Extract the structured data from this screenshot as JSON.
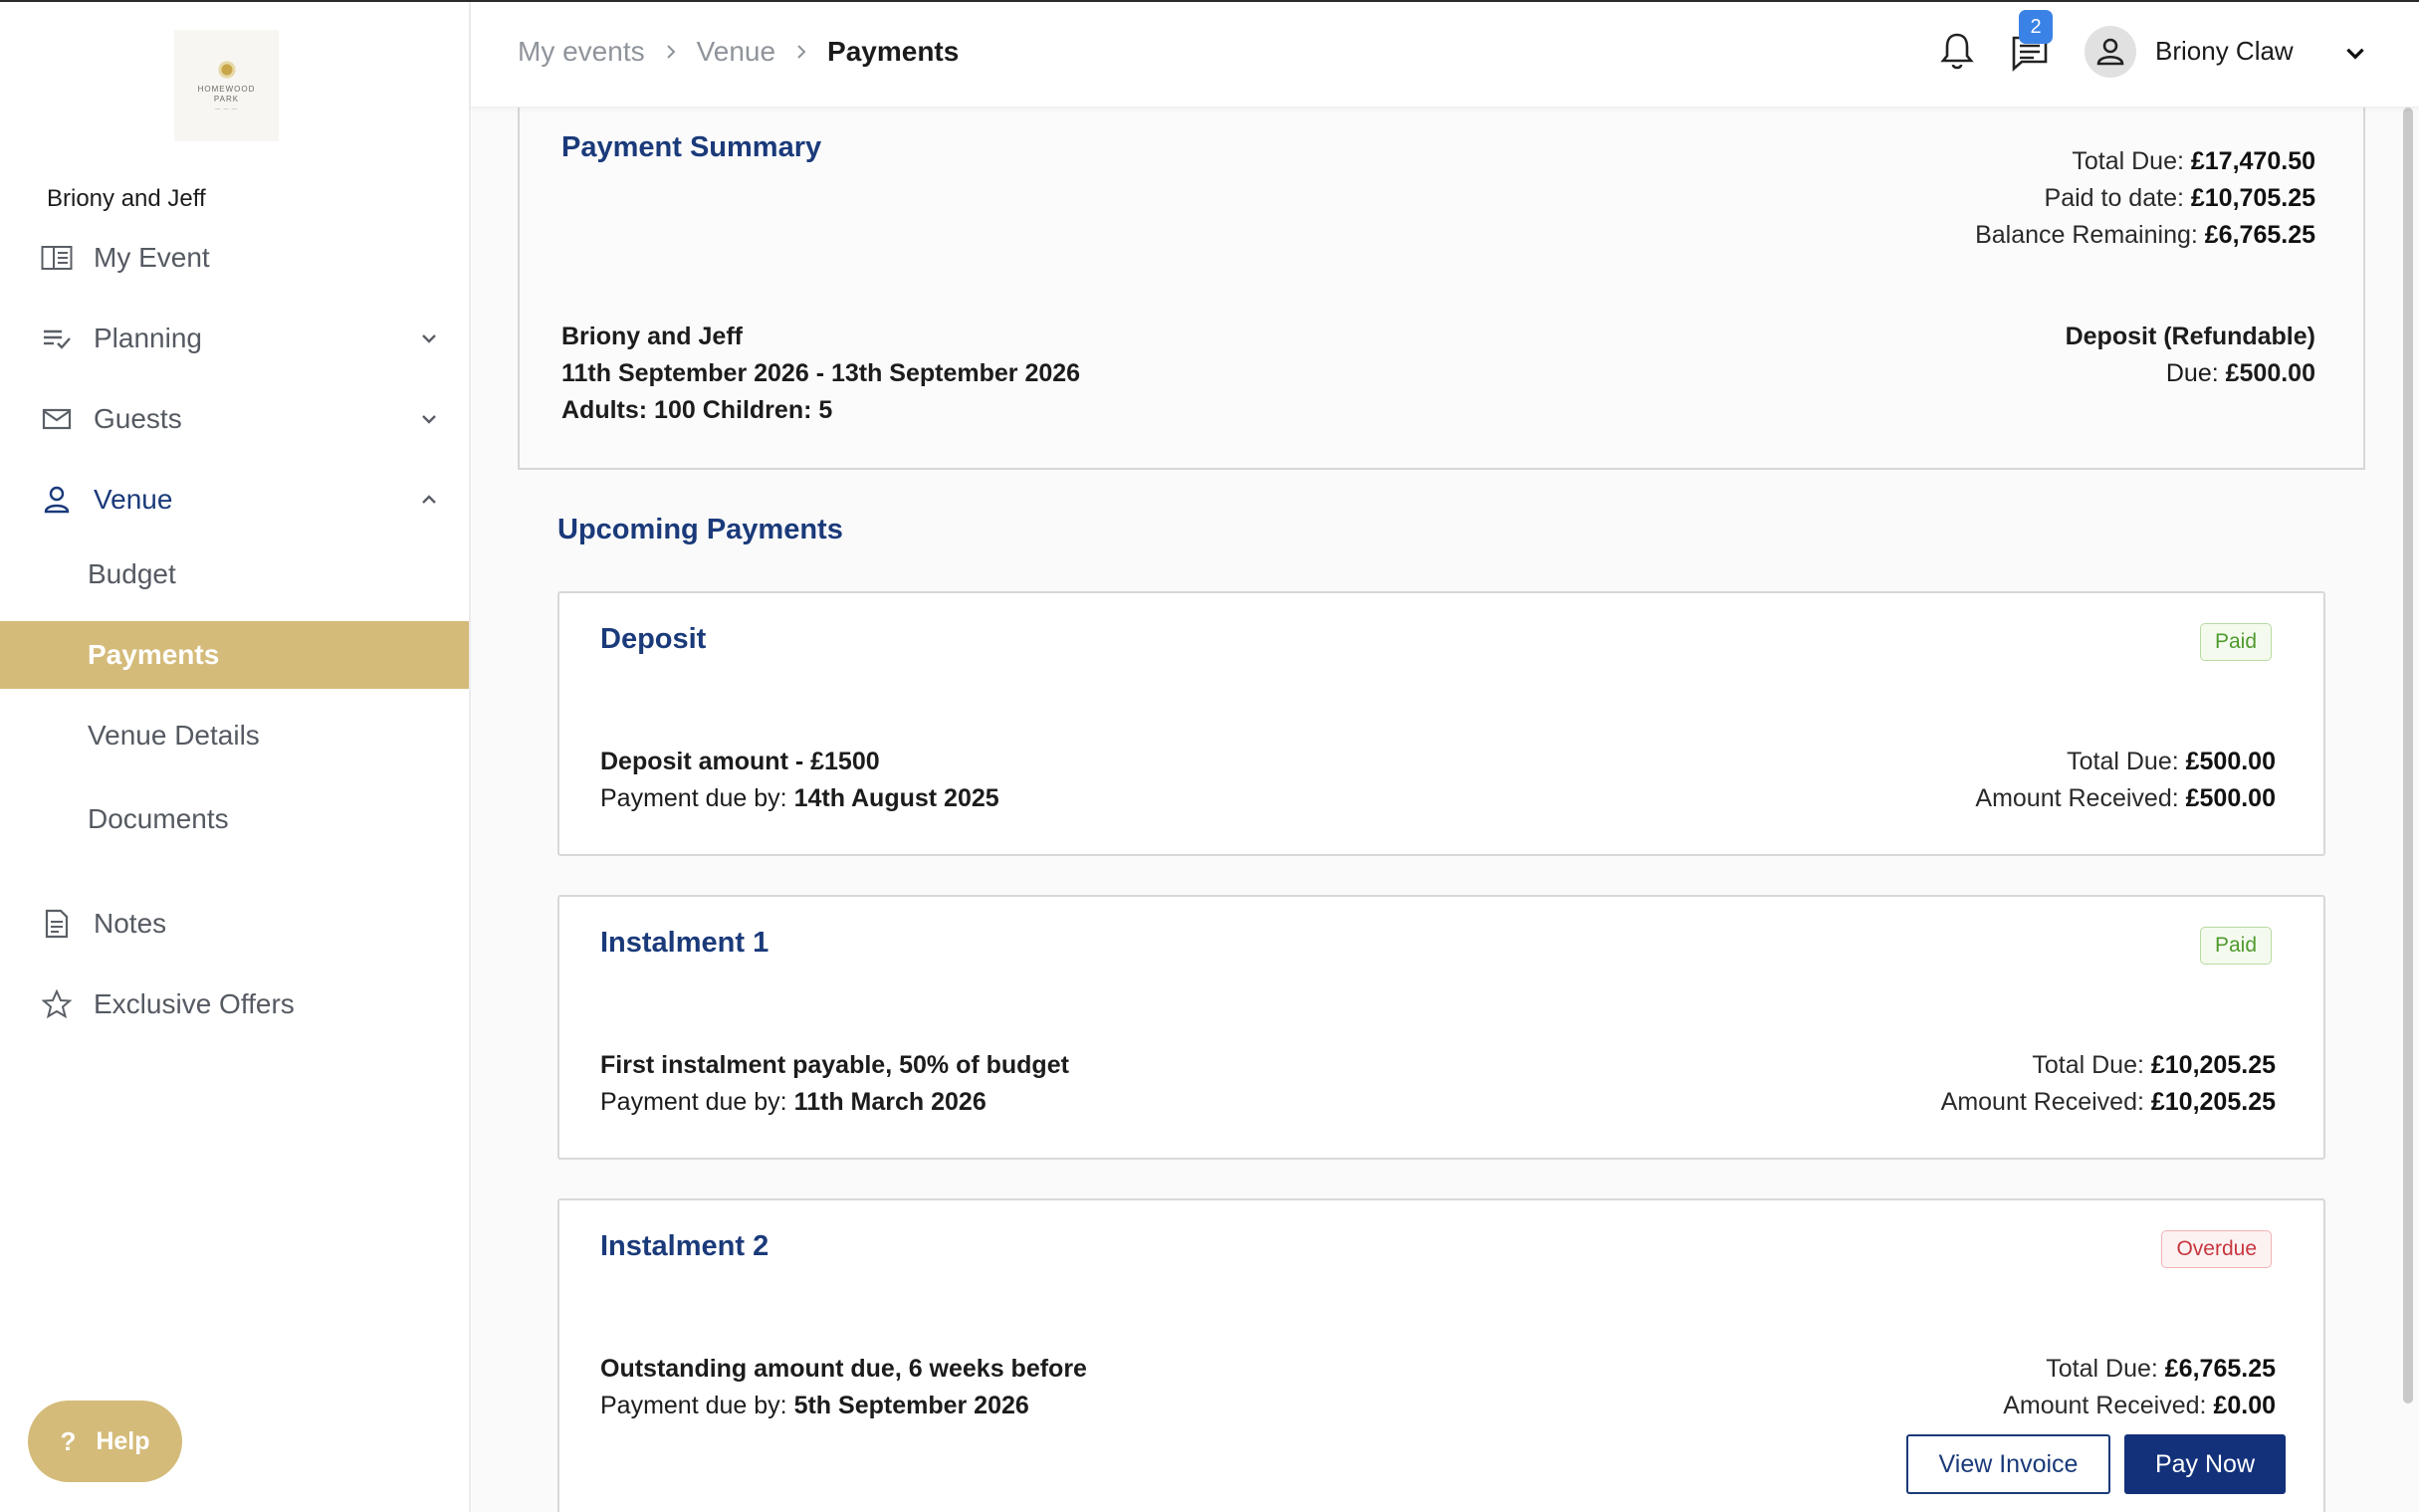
{
  "app": {
    "logo_line1": "HOMEWOOD",
    "logo_line2": "PARK",
    "event_name": "Briony and Jeff"
  },
  "colors": {
    "accent": "#d4bb7a",
    "navy": "#1a3a7a",
    "paid": "#4f9a2d",
    "overdue": "#c7373f",
    "badge_blue": "#3b82e6"
  },
  "sidebar": {
    "items": [
      {
        "label": "My Event",
        "icon": "book-icon"
      },
      {
        "label": "Planning",
        "icon": "checklist-icon"
      },
      {
        "label": "Guests",
        "icon": "mail-icon"
      },
      {
        "label": "Venue",
        "icon": "person-icon"
      }
    ],
    "venue_sub": [
      {
        "label": "Budget"
      },
      {
        "label": "Payments"
      },
      {
        "label": "Venue Details"
      },
      {
        "label": "Documents"
      }
    ],
    "notes": "Notes",
    "offers": "Exclusive Offers",
    "help": "Help"
  },
  "header": {
    "breadcrumbs": [
      "My events",
      "Venue",
      "Payments"
    ],
    "message_count": "2",
    "user_name": "Briony Claw"
  },
  "summary": {
    "title": "Payment Summary",
    "total_due_label": "Total Due:",
    "total_due": "£17,470.50",
    "paid_label": "Paid to date:",
    "paid": "£10,705.25",
    "balance_label": "Balance Remaining:",
    "balance": "£6,765.25",
    "event_name": "Briony and Jeff",
    "dates": "11th September 2026 - 13th September 2026",
    "guests": "Adults: 100 Children: 5",
    "deposit_title": "Deposit (Refundable)",
    "deposit_due_label": "Due:",
    "deposit_due": "£500.00"
  },
  "upcoming": {
    "title": "Upcoming Payments",
    "payments": [
      {
        "title": "Deposit",
        "status": "Paid",
        "description": "Deposit amount - £1500",
        "due_label": "Payment due by:",
        "due_date": "14th August 2025",
        "total_label": "Total Due:",
        "total": "£500.00",
        "received_label": "Amount Received:",
        "received": "£500.00"
      },
      {
        "title": "Instalment 1",
        "status": "Paid",
        "description": "First instalment payable, 50% of budget",
        "due_label": "Payment due by:",
        "due_date": "11th March 2026",
        "total_label": "Total Due:",
        "total": "£10,205.25",
        "received_label": "Amount Received:",
        "received": "£10,205.25"
      },
      {
        "title": "Instalment 2",
        "status": "Overdue",
        "description": "Outstanding amount due, 6 weeks before",
        "due_label": "Payment due by:",
        "due_date": "5th September 2026",
        "total_label": "Total Due:",
        "total": "£6,765.25",
        "received_label": "Amount Received:",
        "received": "£0.00",
        "view_invoice": "View Invoice",
        "pay_now": "Pay Now"
      }
    ]
  }
}
